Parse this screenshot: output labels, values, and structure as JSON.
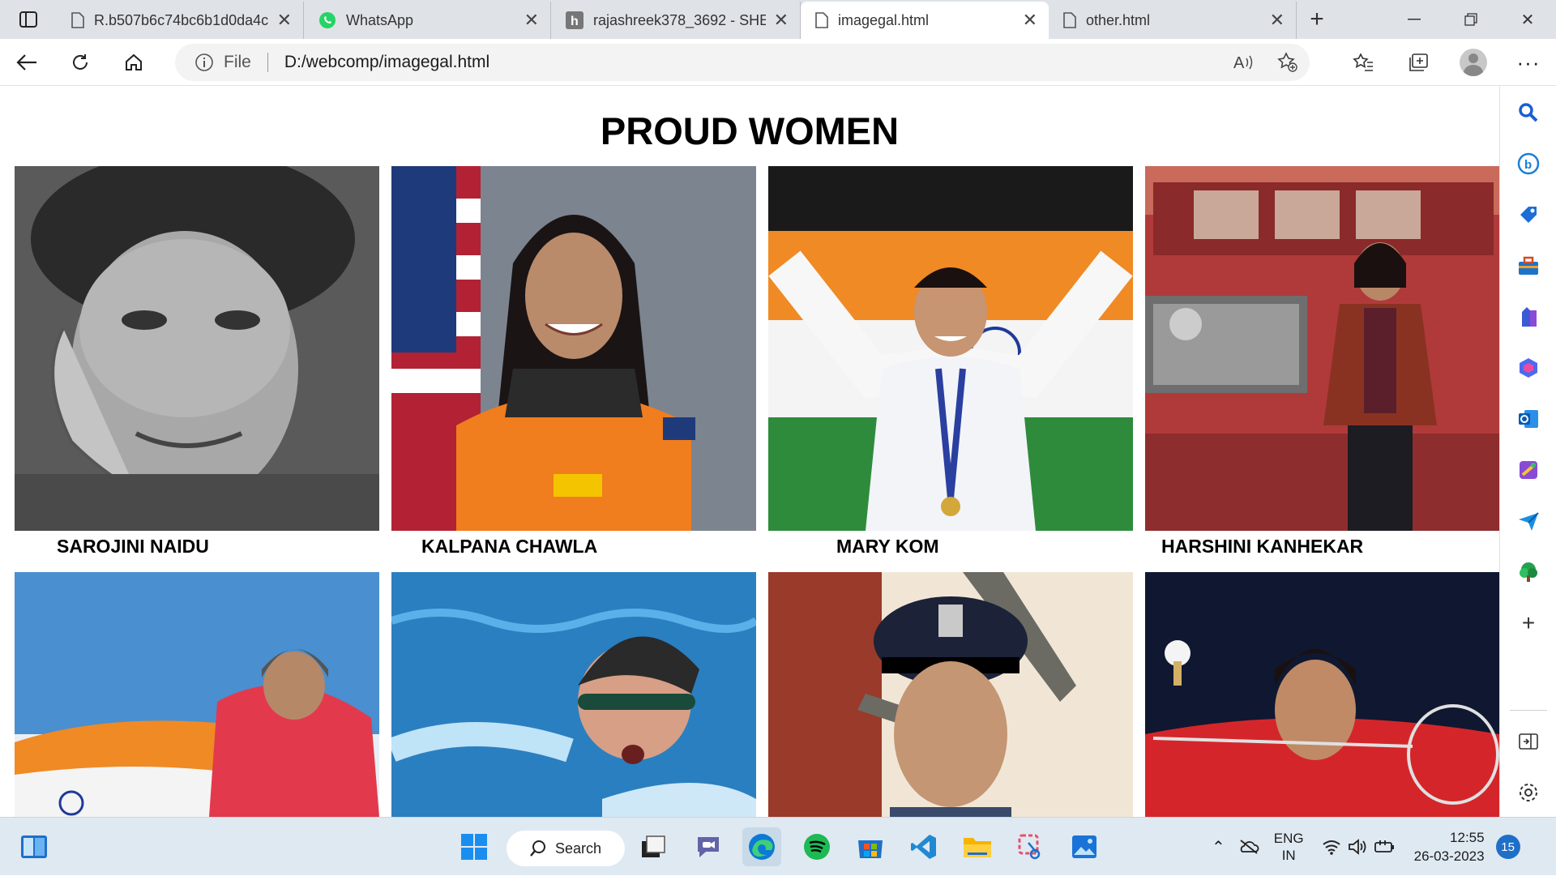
{
  "browser": {
    "tabs": [
      {
        "title": "R.b507b6c74bc6b1d0da4c",
        "icon": "page-icon",
        "active": false
      },
      {
        "title": "WhatsApp",
        "icon": "whatsapp-icon",
        "active": false
      },
      {
        "title": "rajashreek378_3692 - SHE",
        "icon": "h-site-icon",
        "active": false
      },
      {
        "title": "imagegal.html",
        "icon": "page-icon",
        "active": true
      },
      {
        "title": "other.html",
        "icon": "page-icon",
        "active": false
      }
    ],
    "address": {
      "scheme_label": "File",
      "url": "D:/webcomp/imagegal.html"
    }
  },
  "page": {
    "title": "PROUD WOMEN",
    "gallery": [
      {
        "caption": "SAROJINI NAIDU"
      },
      {
        "caption": "KALPANA CHAWLA"
      },
      {
        "caption": "MARY KOM"
      },
      {
        "caption": "HARSHINI KANHEKAR"
      },
      {
        "caption": ""
      },
      {
        "caption": ""
      },
      {
        "caption": ""
      },
      {
        "caption": ""
      }
    ]
  },
  "sidebar": {
    "icons": [
      "search-icon",
      "bing-icon",
      "shopping-tag-icon",
      "toolbox-icon",
      "games-icon",
      "office-icon",
      "outlook-icon",
      "designer-icon",
      "send-icon",
      "tree-icon",
      "add-icon",
      "split-screen-icon",
      "settings-icon"
    ]
  },
  "taskbar": {
    "search_label": "Search",
    "lang_top": "ENG",
    "lang_bottom": "IN",
    "time": "12:55",
    "date": "26-03-2023",
    "notification_count": "15"
  }
}
